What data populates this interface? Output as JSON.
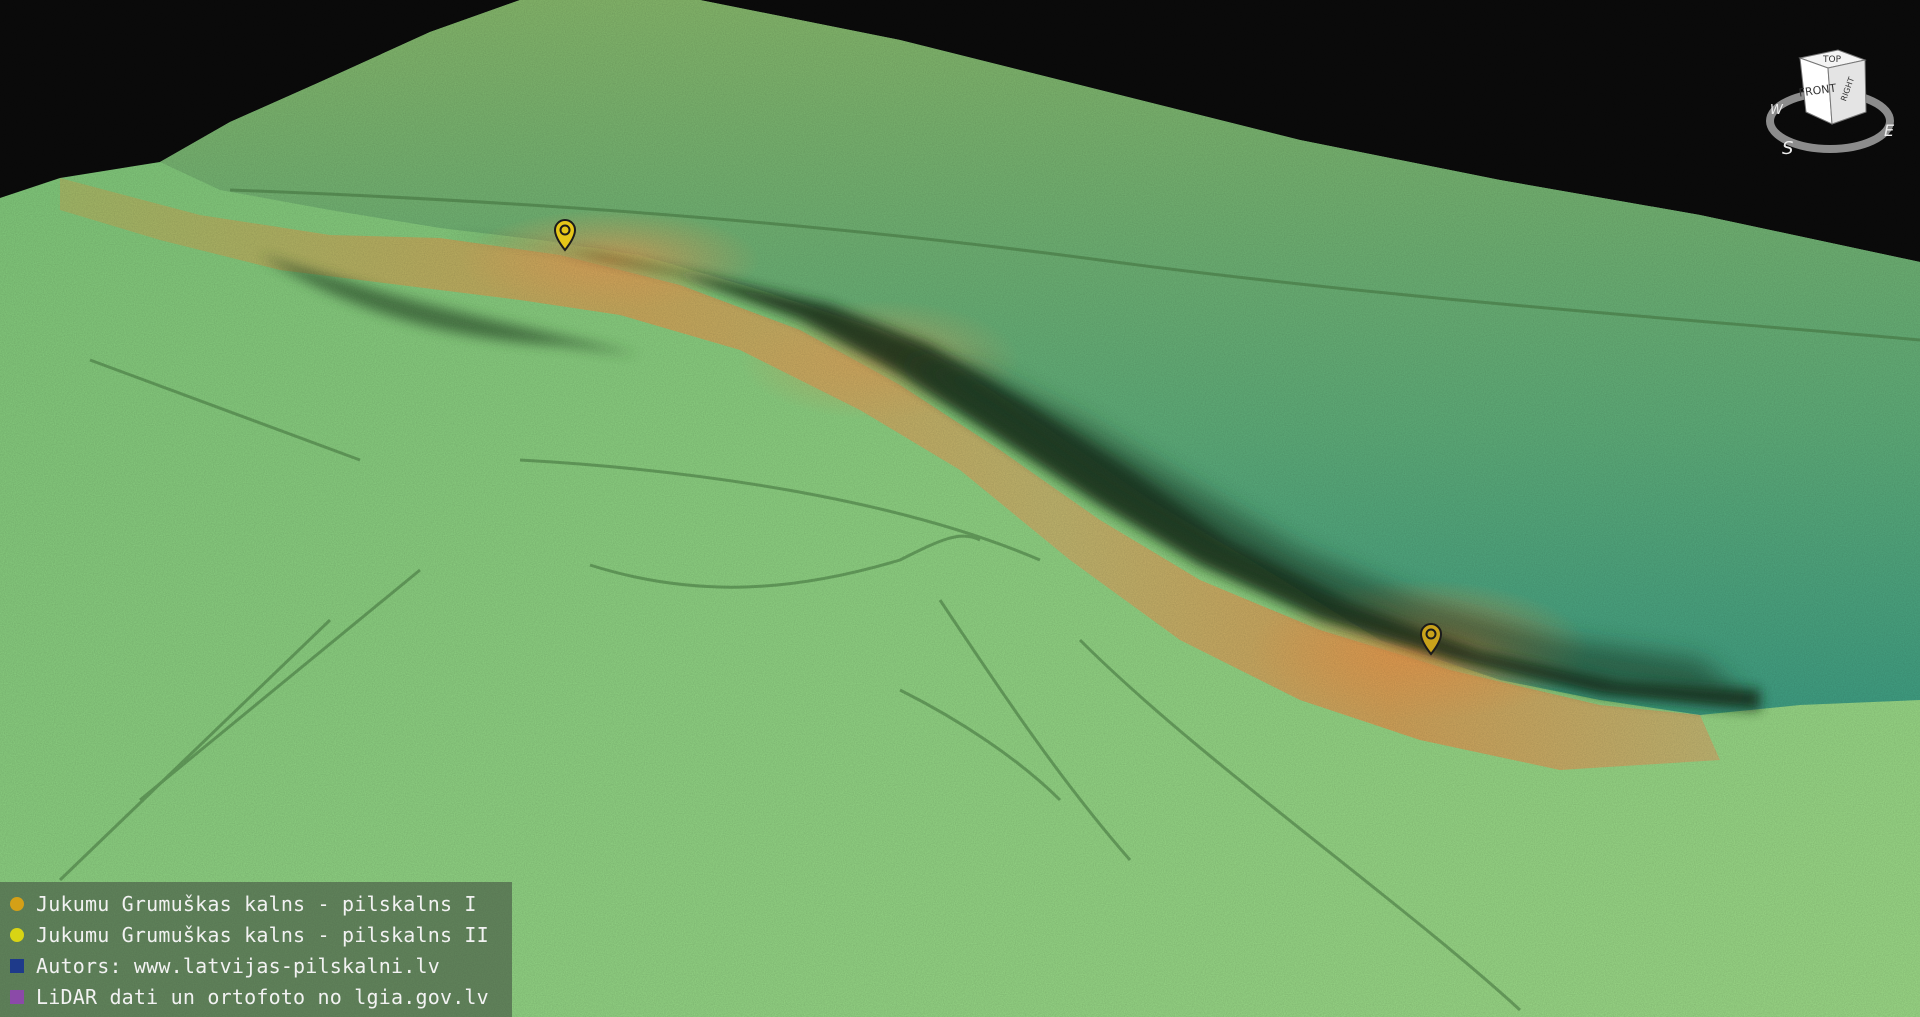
{
  "legend": {
    "items": [
      {
        "label": "Jukumu Grumuškas kalns - pilskalns I",
        "color": "#d4a017",
        "shape": "round"
      },
      {
        "label": "Jukumu Grumuškas kalns - pilskalns II",
        "color": "#d8d414",
        "shape": "round"
      },
      {
        "label": "Autors: www.latvijas-pilskalni.lv",
        "color": "#1e3a8a",
        "shape": "square"
      },
      {
        "label": "LiDAR dati un ortofoto no lgia.gov.lv",
        "color": "#8b4aa8",
        "shape": "square"
      }
    ]
  },
  "navcube": {
    "top": "TOP",
    "front": "FRONT",
    "right": "RIGHT",
    "compass_s": "S",
    "compass_e": "E",
    "compass_w": "W"
  },
  "markers": [
    {
      "name": "pilskalns I",
      "color": "#e6c619"
    },
    {
      "name": "pilskalns II",
      "color": "#c9a21b"
    }
  ]
}
